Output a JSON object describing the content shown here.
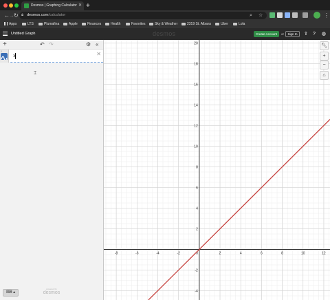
{
  "browser": {
    "tab_title": "Desmos | Graphing Calculator",
    "url_host": "desmos.com",
    "url_path": "/calculator",
    "bookmarks": [
      "Apps",
      "LTS",
      "Plumafina",
      "Apple",
      "Finances",
      "Health",
      "Favorites",
      "Sky & Weather",
      "2319 St. Albans",
      "Uber",
      "Lola"
    ]
  },
  "header": {
    "graph_title": "Untitled Graph",
    "brand": "desmos",
    "create_account": "Create Account",
    "or": "or",
    "sign_in": "Sign In"
  },
  "expressions": [
    {
      "index": "1",
      "latex": "x",
      "color": "#c74440"
    }
  ],
  "footer": {
    "powered_by": "powered by",
    "brand": "desmos"
  },
  "graph": {
    "xlim": [
      -9.2,
      12.6
    ],
    "ylim": [
      -4.9,
      20.3
    ],
    "x_ticks": [
      -8,
      -6,
      -4,
      -2,
      2,
      4,
      6,
      8,
      10,
      12
    ],
    "y_ticks": [
      -4,
      -2,
      2,
      4,
      6,
      8,
      10,
      12,
      14,
      16,
      18,
      20
    ],
    "origin_label": "0",
    "grid": true
  },
  "chart_data": {
    "type": "line",
    "series": [
      {
        "values": "y = x",
        "x": [
          -4.9,
          12.6
        ],
        "y": [
          -4.9,
          12.6
        ]
      }
    ],
    "xlim": [
      -9.2,
      12.6
    ],
    "ylim": [
      -4.9,
      20.3
    ],
    "grid": true
  }
}
